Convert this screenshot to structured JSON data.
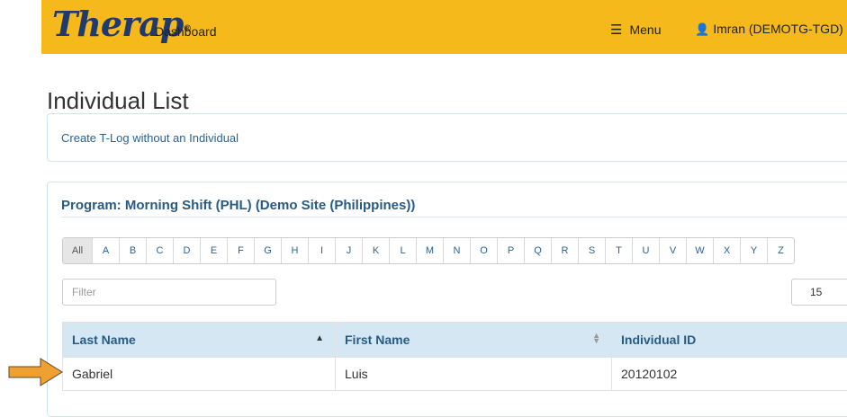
{
  "header": {
    "logo": "Therap",
    "logo_mark": "®",
    "nav_label": "Dashboard",
    "menu_label": "Menu",
    "user_label": "Imran (DEMOTG-TGD)"
  },
  "page": {
    "title": "Individual List"
  },
  "create_link": {
    "label": "Create T-Log without an Individual"
  },
  "program": {
    "title": "Program: Morning Shift (PHL) (Demo Site (Philippines))",
    "letters": [
      "All",
      "A",
      "B",
      "C",
      "D",
      "E",
      "F",
      "G",
      "H",
      "I",
      "J",
      "K",
      "L",
      "M",
      "N",
      "O",
      "P",
      "Q",
      "R",
      "S",
      "T",
      "U",
      "V",
      "W",
      "X",
      "Y",
      "Z"
    ],
    "selected_letter": "All",
    "filter_placeholder": "Filter",
    "page_size": "15"
  },
  "table": {
    "columns": [
      {
        "label": "Last Name",
        "sort": "asc"
      },
      {
        "label": "First Name",
        "sort": "none"
      },
      {
        "label": "Individual ID",
        "sort": ""
      }
    ],
    "rows": [
      {
        "last_name": "Gabriel",
        "first_name": "Luis",
        "individual_id": "20120102"
      }
    ]
  },
  "colors": {
    "header_bg": "#f6b91b",
    "logo": "#1f3a6e",
    "table_header_bg": "#d5e7f3",
    "accent_text": "#275b85",
    "pointer_arrow": "#f0a030"
  },
  "icons": {
    "menu": "hamburger-icon",
    "user": "user-icon",
    "sort_asc": "sort-asc-icon",
    "sort_none": "sort-icon",
    "pointer": "pointer-arrow-icon"
  }
}
